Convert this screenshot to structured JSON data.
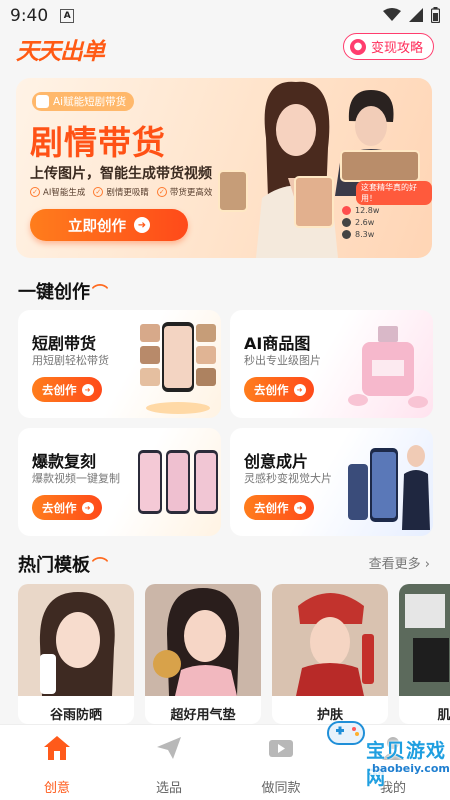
{
  "status_bar": {
    "time": "9:40",
    "notif": "A"
  },
  "header": {
    "logo": "天天出单",
    "monetize_label": "变现攻略",
    "accent": "#ff5a14"
  },
  "banner": {
    "tag": "Ai赋能短剧带货",
    "title": "剧情带货",
    "subtitle": "上传图片，智能生成带货视频",
    "features": [
      "AI智能生成",
      "剧情更吸睛",
      "带货更高效"
    ],
    "cta": "立即创作",
    "film_label": "这套精华真的好用！",
    "stats": [
      "12.8w",
      "2.6w",
      "8.3w"
    ]
  },
  "one_click": {
    "title": "一键创作",
    "cards": [
      {
        "title": "短剧带货",
        "desc": "用短剧轻松带货",
        "button": "去创作"
      },
      {
        "title": "AI商品图",
        "desc": "秒出专业级图片",
        "button": "去创作"
      },
      {
        "title": "爆款复刻",
        "desc": "爆款视频一键复制",
        "button": "去创作"
      },
      {
        "title": "创意成片",
        "desc": "灵感秒变视觉大片",
        "button": "去创作"
      }
    ]
  },
  "hot_templates": {
    "title": "热门模板",
    "see_more": "查看更多 ›",
    "items": [
      {
        "label": "谷雨防晒"
      },
      {
        "label": "超好用气垫"
      },
      {
        "label": "护肤"
      },
      {
        "label": "肌底修"
      }
    ]
  },
  "bottom_nav": [
    {
      "label": "创意",
      "icon": "home-icon",
      "active": true
    },
    {
      "label": "选品",
      "icon": "send-icon",
      "active": false
    },
    {
      "label": "做同款",
      "icon": "video-icon",
      "active": false
    },
    {
      "label": "我的",
      "icon": "profile-icon",
      "active": false
    }
  ],
  "watermark": {
    "title": "宝贝游戏网",
    "url": "baobeiy.com"
  }
}
